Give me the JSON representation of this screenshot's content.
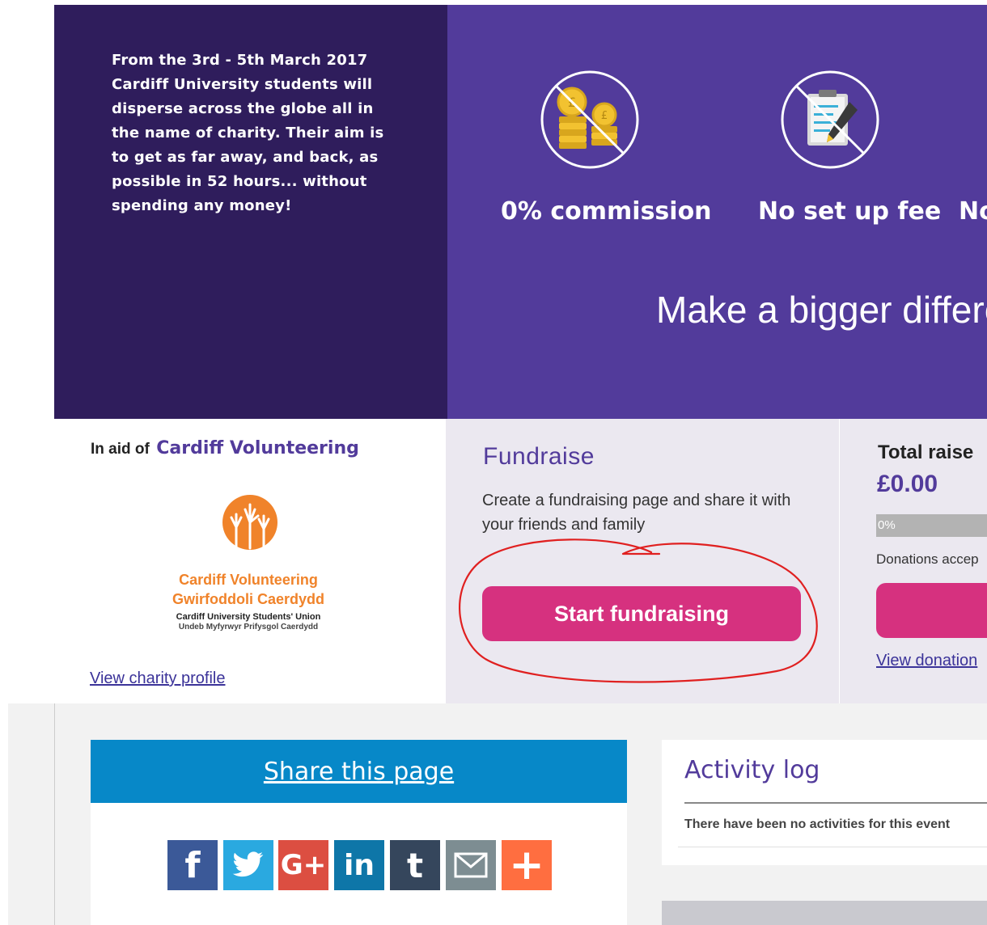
{
  "hero": {
    "description": "From the 3rd - 5th March 2017 Cardiff University students will disperse across the globe all in the name of charity. Their aim is to get as far away, and back, as possible in 52 hours... without spending any money!",
    "features": [
      {
        "label": "0% commission",
        "icon": "no-coins-icon"
      },
      {
        "label": "No set up fee",
        "icon": "no-form-icon"
      },
      {
        "label": "No",
        "icon": "feature-icon"
      }
    ],
    "tagline": "Make a bigger differen"
  },
  "charity": {
    "prefix": "In aid of",
    "name": "Cardiff Volunteering",
    "logo": {
      "line1": "Cardiff Volunteering",
      "line2": "Gwirfoddoli Caerdydd",
      "line3": "Cardiff University Students' Union",
      "line4": "Undeb Myfyrwyr Prifysgol Caerdydd"
    },
    "profile_link": "View charity profile"
  },
  "fundraise": {
    "title": "Fundraise",
    "description": "Create a fundraising page and share it with your friends and family",
    "button": "Start fundraising"
  },
  "totals": {
    "title": "Total raise",
    "amount": "£0.00",
    "progress_label": "0%",
    "progress_fraction": 0,
    "donations_note": "Donations accep",
    "view_donations": "View donation"
  },
  "share": {
    "title": "Share this page",
    "buttons": [
      {
        "name": "facebook",
        "glyph": "f",
        "color": "#3b5998"
      },
      {
        "name": "twitter",
        "glyph": "",
        "color": "#2aa9e0"
      },
      {
        "name": "google-plus",
        "glyph": "G+",
        "color": "#dc4e41"
      },
      {
        "name": "linkedin",
        "glyph": "in",
        "color": "#0e76a8"
      },
      {
        "name": "tumblr",
        "glyph": "t",
        "color": "#35465c"
      },
      {
        "name": "email",
        "glyph": "",
        "color": "#7d8d92"
      },
      {
        "name": "more",
        "glyph": "+",
        "color": "#ff6e40"
      }
    ]
  },
  "activity": {
    "title": "Activity log",
    "empty": "There have been no activities for this event"
  },
  "colors": {
    "brand_purple": "#523b9b",
    "dark_purple": "#2f1d5c",
    "cta_pink": "#d6317f",
    "share_blue": "#0788c8",
    "annotation_red": "#e02020"
  }
}
